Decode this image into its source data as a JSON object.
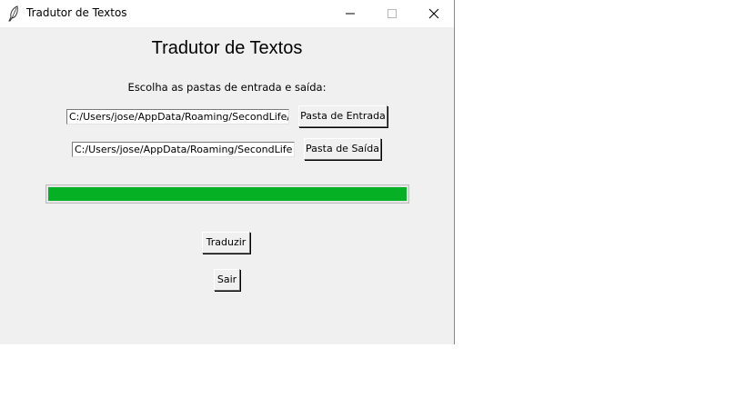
{
  "window": {
    "title": "Tradutor de Textos",
    "icon": "feather-icon",
    "controls": [
      "minimize-icon",
      "maximize-icon",
      "close-icon"
    ]
  },
  "main": {
    "heading": "Tradutor de Textos",
    "subtitle": "Escolha as pastas de entrada e saída:",
    "input_folder": {
      "value": "C:/Users/jose/AppData/Roaming/SecondLife/",
      "button_label": "Pasta de Entrada"
    },
    "output_folder": {
      "value": "C:/Users/jose/AppData/Roaming/SecondLife",
      "button_label": "Pasta de Saída"
    },
    "progress": {
      "fraction": 1.0,
      "color": "#06b025"
    },
    "translate_label": "Traduzir",
    "exit_label": "Sair"
  },
  "colors": {
    "window_bg": "#f0f0f0",
    "titlebar_bg": "#ffffff"
  }
}
